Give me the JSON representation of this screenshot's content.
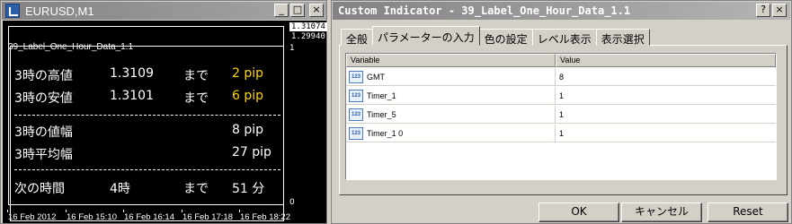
{
  "chart_window": {
    "title": "EURUSD,M1",
    "price_label_top": "1.31074",
    "price_label_second": "1.29940",
    "scale_max": "1",
    "scale_min": "0",
    "time_labels": [
      "16 Feb 2012",
      "16 Feb 15:10",
      "16 Feb 16:14",
      "16 Feb 17:18",
      "16 Feb 18:22"
    ],
    "indicator_name": "39_Label_One_Hour_Data_1.1",
    "rows": {
      "high_label": "3時の高値",
      "high_value": "1.3109",
      "high_made": "まで",
      "high_pip": "2 pip",
      "low_label": "3時の安値",
      "low_value": "1.3101",
      "low_made": "まで",
      "low_pip": "6 pip",
      "range_label": "3時の値幅",
      "range_pip": "8 pip",
      "avg_label": "3時平均幅",
      "avg_pip": "27 pip",
      "next_label": "次の時間",
      "next_value": "4時",
      "next_made": "まで",
      "next_min": "51 分"
    },
    "buttons": {
      "minimize": "_",
      "maximize": "□",
      "close": "×"
    }
  },
  "dialog": {
    "title": "Custom Indicator - 39_Label_One_Hour_Data_1.1",
    "help": "?",
    "close": "×",
    "tabs": [
      "全般",
      "パラメーターの入力",
      "色の設定",
      "レベル表示",
      "表示選択"
    ],
    "active_tab": 1,
    "grid": {
      "headers": [
        "Variable",
        "Value"
      ],
      "rows": [
        {
          "variable": "GMT",
          "value": "8",
          "icon": "123"
        },
        {
          "variable": "Timer_1",
          "value": "1",
          "icon": "123"
        },
        {
          "variable": "Timer_5",
          "value": "1",
          "icon": "123"
        },
        {
          "variable": "Timer_1 0",
          "value": "1",
          "icon": "123"
        }
      ]
    },
    "footer": {
      "ok": "OK",
      "cancel": "キャンセル",
      "reset": "Reset"
    }
  }
}
